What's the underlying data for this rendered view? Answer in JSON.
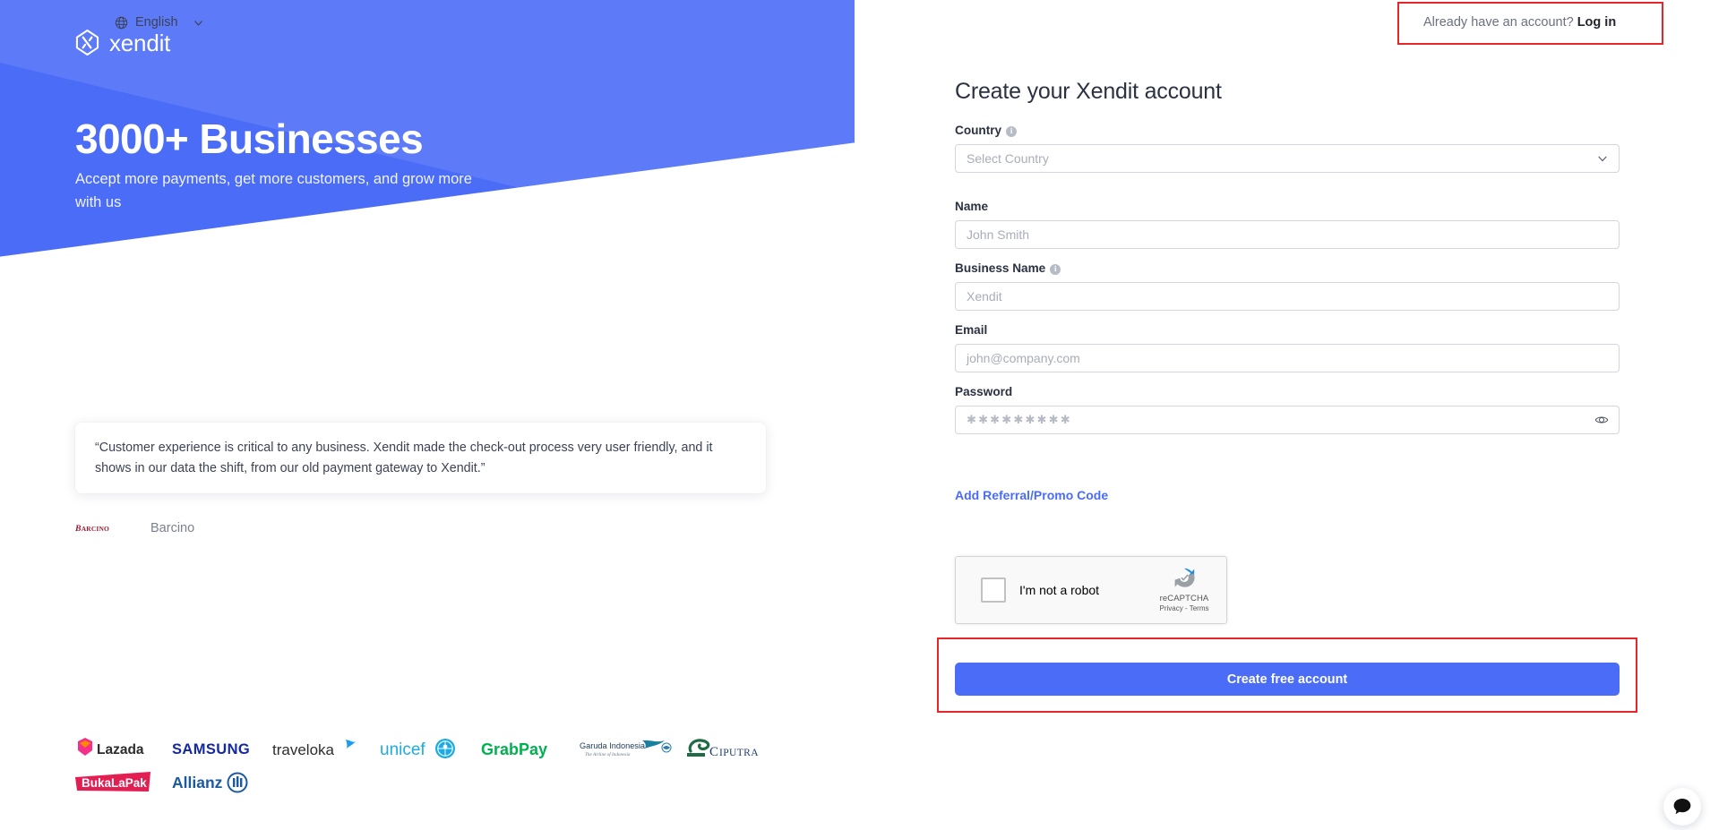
{
  "brand": {
    "name": "xendit",
    "logo_icon": "xendit-logo-icon",
    "accent_color": "#4a6cf7",
    "annotation_color": "#e8252a"
  },
  "left": {
    "headline": "3000+ Businesses",
    "subheadline": "Accept more payments, get more customers, and grow more with us",
    "testimonial": {
      "quote": "“Customer experience is critical to any business. Xendit made the check-out process very user friendly, and it shows in our data the shift, from our old payment gateway to Xendit.”",
      "company_logo": "barcino-logo",
      "company_name": "Barcino"
    },
    "client_logos_row1": [
      {
        "name": "Lazada",
        "icon": "lazada-logo"
      },
      {
        "name": "SAMSUNG",
        "icon": "samsung-logo"
      },
      {
        "name": "traveloka",
        "icon": "traveloka-logo"
      },
      {
        "name": "unicef",
        "icon": "unicef-logo"
      },
      {
        "name": "GrabPay",
        "icon": "grabpay-logo"
      },
      {
        "name": "Garuda Indonesia",
        "tagline": "The Airline of Indonesia",
        "icon": "garuda-indonesia-logo"
      },
      {
        "name": "CIPUTRA",
        "icon": "ciputra-logo"
      }
    ],
    "client_logos_row2": [
      {
        "name": "BukaLapak",
        "icon": "bukalapak-logo"
      },
      {
        "name": "Allianz",
        "icon": "allianz-logo"
      }
    ]
  },
  "header": {
    "language": "English",
    "globe_icon": "globe-icon",
    "chevron_icon": "chevron-down-icon",
    "account_prompt": "Already have an account?",
    "login_label": "Log in"
  },
  "form": {
    "title": "Create your Xendit account",
    "country": {
      "label": "Country",
      "placeholder": "Select Country",
      "info_icon": "info-icon",
      "chevron_icon": "chevron-down-icon"
    },
    "name": {
      "label": "Name",
      "placeholder": "John Smith"
    },
    "business_name": {
      "label": "Business Name",
      "placeholder": "Xendit",
      "info_icon": "info-icon"
    },
    "email": {
      "label": "Email",
      "placeholder": "john@company.com"
    },
    "password": {
      "label": "Password",
      "placeholder": "✱✱✱✱✱✱✱✱✱",
      "toggle_icon": "eye-icon"
    },
    "referral_label": "Add Referral/Promo Code",
    "recaptcha": {
      "checkbox_label": "I'm not a robot",
      "brand": "reCAPTCHA",
      "links": "Privacy - Terms",
      "logo_icon": "recaptcha-logo-icon"
    },
    "submit_label": "Create free account"
  },
  "widgets": {
    "chat_icon": "chat-bubble-icon"
  }
}
